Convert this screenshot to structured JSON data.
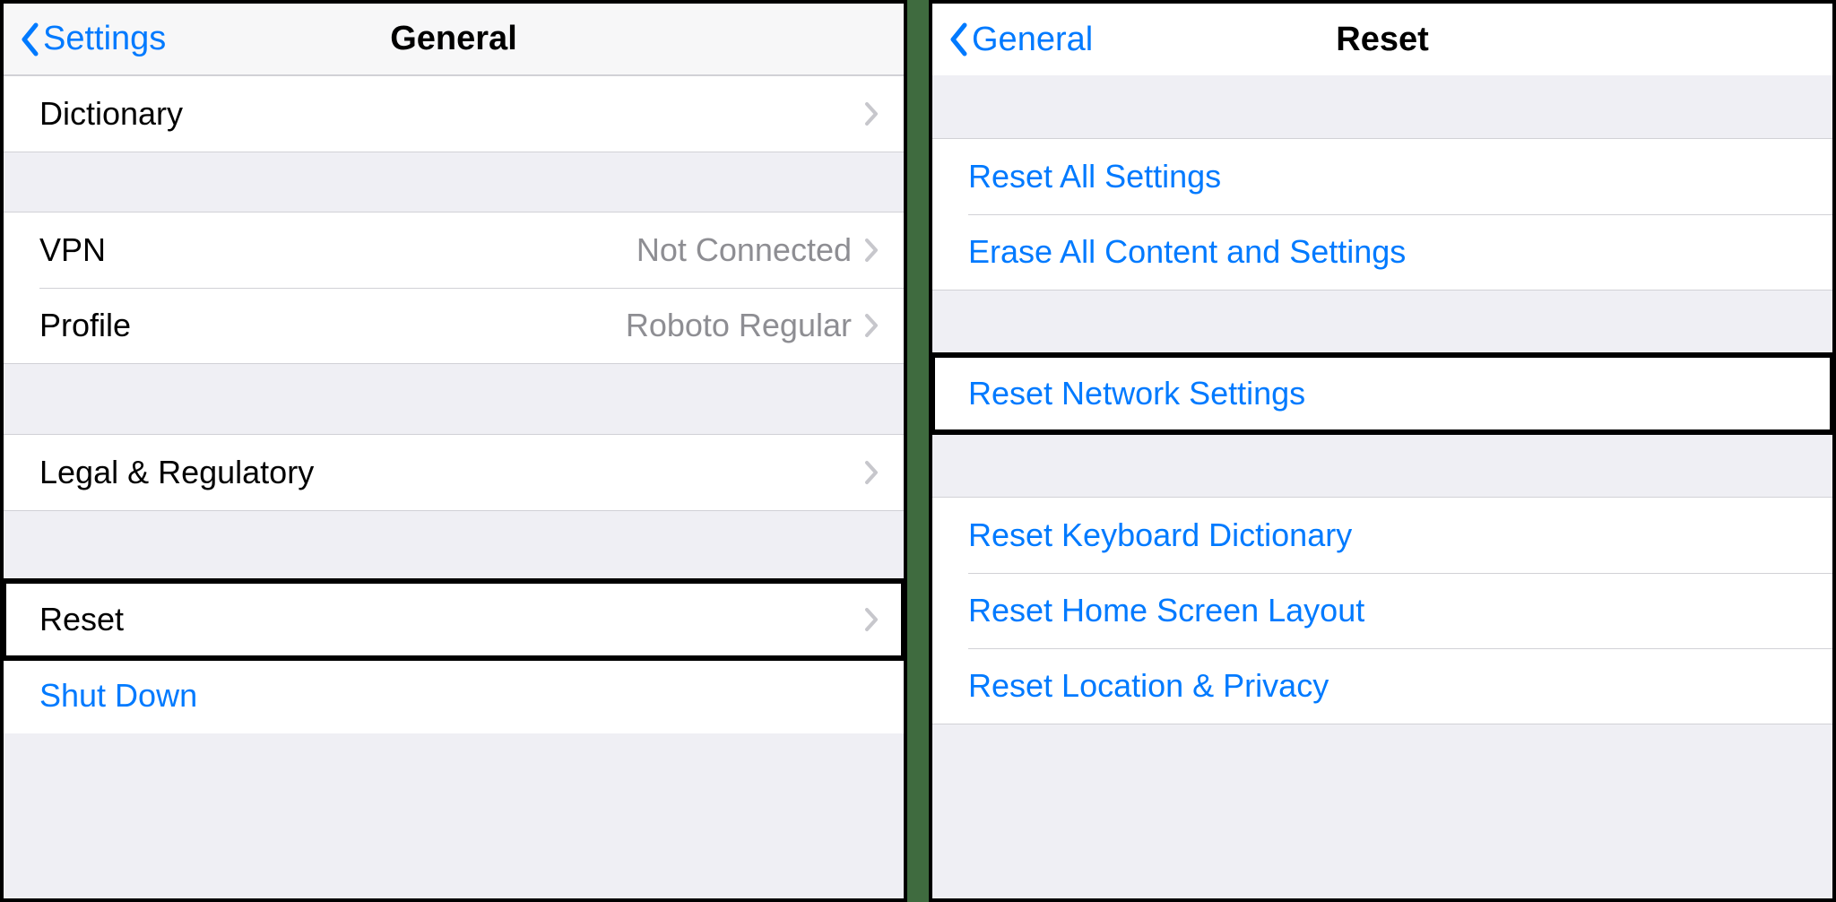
{
  "left": {
    "back_label": "Settings",
    "title": "General",
    "rows": {
      "dictionary": "Dictionary",
      "vpn": "VPN",
      "vpn_status": "Not Connected",
      "profile": "Profile",
      "profile_value": "Roboto Regular",
      "legal": "Legal & Regulatory",
      "reset": "Reset",
      "shutdown": "Shut Down"
    }
  },
  "right": {
    "back_label": "General",
    "title": "Reset",
    "rows": {
      "reset_all": "Reset All Settings",
      "erase_all": "Erase All Content and Settings",
      "reset_network": "Reset Network Settings",
      "reset_keyboard": "Reset Keyboard Dictionary",
      "reset_home": "Reset Home Screen Layout",
      "reset_location": "Reset Location & Privacy"
    }
  }
}
